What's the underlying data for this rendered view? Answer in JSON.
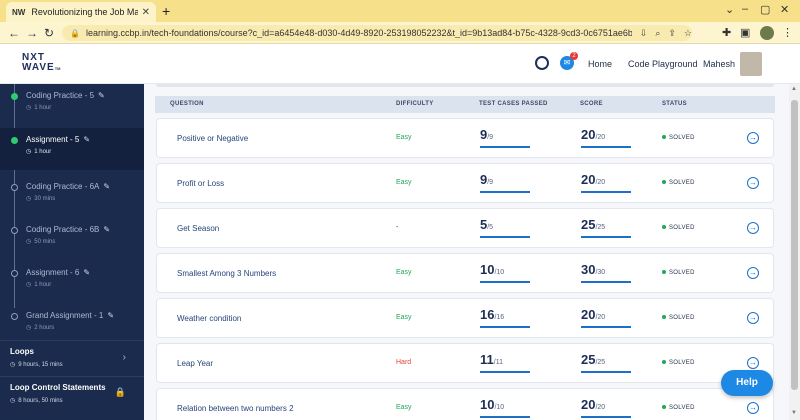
{
  "browser": {
    "tab_title": "Revolutionizing the Job Market | N",
    "favicon": "NW",
    "url": "learning.ccbp.in/tech-foundations/course?c_id=a6454e48-d030-4d49-8920-253198052232&t_id=9b13ad84-b75c-4328-9cd3-0c6751ae6b..."
  },
  "header": {
    "logo_line1": "NXT",
    "logo_line2": "WAVE",
    "logo_tm": "TM",
    "notification_count": "2",
    "home": "Home",
    "code_playground": "Code Playground",
    "user_name": "Mahesh"
  },
  "sidebar": {
    "items": [
      {
        "title": "Coding Practice - 5",
        "duration": "1 hour"
      },
      {
        "title": "Assignment - 5",
        "duration": "1 hour"
      },
      {
        "title": "Coding Practice - 6A",
        "duration": "30 mins"
      },
      {
        "title": "Coding Practice - 6B",
        "duration": "50 mins"
      },
      {
        "title": "Assignment - 6",
        "duration": "1 hour"
      },
      {
        "title": "Grand Assignment - 1",
        "duration": "2 hours"
      }
    ],
    "sections": [
      {
        "title": "Loops",
        "meta": "9 hours, 15 mins"
      },
      {
        "title": "Loop Control Statements",
        "meta": "8 hours, 50 mins"
      }
    ]
  },
  "table": {
    "headers": {
      "question": "QUESTION",
      "difficulty": "DIFFICULTY",
      "tests": "TEST CASES PASSED",
      "score": "SCORE",
      "status": "STATUS"
    },
    "rows": [
      {
        "question": "Positive or Negative",
        "difficulty": "Easy",
        "passed": "9",
        "total_tests": "/9",
        "score": "20",
        "max_score": "/20",
        "status": "SOLVED"
      },
      {
        "question": "Profit or Loss",
        "difficulty": "Easy",
        "passed": "9",
        "total_tests": "/9",
        "score": "20",
        "max_score": "/20",
        "status": "SOLVED"
      },
      {
        "question": "Get Season",
        "difficulty": "-",
        "passed": "5",
        "total_tests": "/5",
        "score": "25",
        "max_score": "/25",
        "status": "SOLVED"
      },
      {
        "question": "Smallest Among 3 Numbers",
        "difficulty": "Easy",
        "passed": "10",
        "total_tests": "/10",
        "score": "30",
        "max_score": "/30",
        "status": "SOLVED"
      },
      {
        "question": "Weather condition",
        "difficulty": "Easy",
        "passed": "16",
        "total_tests": "/16",
        "score": "20",
        "max_score": "/20",
        "status": "SOLVED"
      },
      {
        "question": "Leap Year",
        "difficulty": "Hard",
        "passed": "11",
        "total_tests": "/11",
        "score": "25",
        "max_score": "/25",
        "status": "SOLVED"
      },
      {
        "question": "Relation between two numbers 2",
        "difficulty": "Easy",
        "passed": "10",
        "total_tests": "/10",
        "score": "20",
        "max_score": "/20",
        "status": "SOLVED"
      }
    ]
  },
  "help_label": "Help",
  "colors": {
    "sidebar_bg": "#1b2b4d",
    "accent": "#1e6fc9",
    "easy": "#22a65a",
    "hard": "#e0492f",
    "help_button": "#1e88e5"
  },
  "icons": {
    "back": "arrow-left-icon",
    "forward": "arrow-right-icon",
    "reload": "reload-icon",
    "lock": "lock-icon",
    "timer": "stopwatch-icon",
    "chat": "chat-icon",
    "edit": "pencil-icon",
    "clock": "clock-icon",
    "go": "arrow-circle-right-icon"
  }
}
